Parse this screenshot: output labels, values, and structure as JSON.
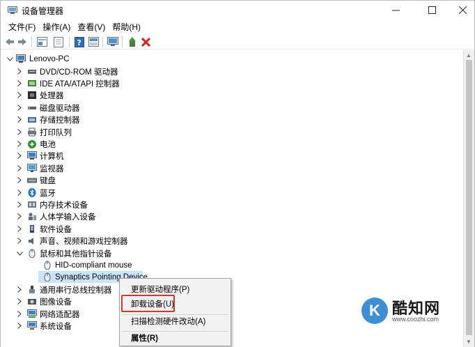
{
  "window": {
    "title": "设备管理器",
    "controls": {
      "minimize": "—",
      "maximize": "☐",
      "close": "✕"
    }
  },
  "menu": [
    "文件(F)",
    "操作(A)",
    "查看(V)",
    "帮助(H)"
  ],
  "toolbar": {
    "buttons": [
      "back-icon",
      "forward-icon",
      "properties-icon",
      "show-hidden-icon",
      "help-icon",
      "scan-icon",
      "update-driver-icon",
      "disable-device-icon",
      "uninstall-icon"
    ]
  },
  "tree": {
    "root": "Lenovo-PC",
    "categories": [
      {
        "label": "DVD/CD-ROM 驱动器",
        "icon": "optical-drive-icon",
        "expanded": false
      },
      {
        "label": "IDE ATA/ATAPI 控制器",
        "icon": "ide-controller-icon",
        "expanded": false
      },
      {
        "label": "处理器",
        "icon": "processor-icon",
        "expanded": false
      },
      {
        "label": "磁盘驱动器",
        "icon": "disk-drive-icon",
        "expanded": false
      },
      {
        "label": "存储控制器",
        "icon": "storage-controller-icon",
        "expanded": false
      },
      {
        "label": "打印队列",
        "icon": "printer-icon",
        "expanded": false
      },
      {
        "label": "电池",
        "icon": "battery-icon",
        "expanded": false
      },
      {
        "label": "计算机",
        "icon": "computer-icon",
        "expanded": false
      },
      {
        "label": "监视器",
        "icon": "monitor-icon",
        "expanded": false
      },
      {
        "label": "键盘",
        "icon": "keyboard-icon",
        "expanded": false
      },
      {
        "label": "蓝牙",
        "icon": "bluetooth-icon",
        "expanded": false
      },
      {
        "label": "内存技术设备",
        "icon": "memory-icon",
        "expanded": false
      },
      {
        "label": "人体学输入设备",
        "icon": "hid-icon",
        "expanded": false
      },
      {
        "label": "软件设备",
        "icon": "software-device-icon",
        "expanded": false
      },
      {
        "label": "声音、视频和游戏控制器",
        "icon": "speaker-icon",
        "expanded": false
      },
      {
        "label": "鼠标和其他指针设备",
        "icon": "mouse-icon",
        "expanded": true
      },
      {
        "label": "HID-compliant mouse",
        "icon": "mouse-icon",
        "child": true
      },
      {
        "label": "Synaptics Pointing Device",
        "icon": "mouse-icon",
        "child": true,
        "selected": true
      },
      {
        "label": "通用串行总线控制器",
        "icon": "usb-icon",
        "expanded": false
      },
      {
        "label": "图像设备",
        "icon": "camera-icon",
        "expanded": false
      },
      {
        "label": "网络适配器",
        "icon": "network-icon",
        "expanded": false
      },
      {
        "label": "系统设备",
        "icon": "system-device-icon",
        "expanded": false
      }
    ]
  },
  "context_menu": {
    "items": [
      "更新驱动程序(P)",
      "卸载设备(U)",
      "扫描检测硬件改动(A)",
      "属性(R)"
    ],
    "highlighted": "卸载设备(U)"
  },
  "watermark": {
    "logo_letter": "K",
    "name": "酷知网",
    "url": "www.coozhi.com"
  },
  "colors": {
    "selection": "#cce4f7",
    "highlight_border": "#d9342b",
    "watermark_blue": "#3f8fd6"
  }
}
